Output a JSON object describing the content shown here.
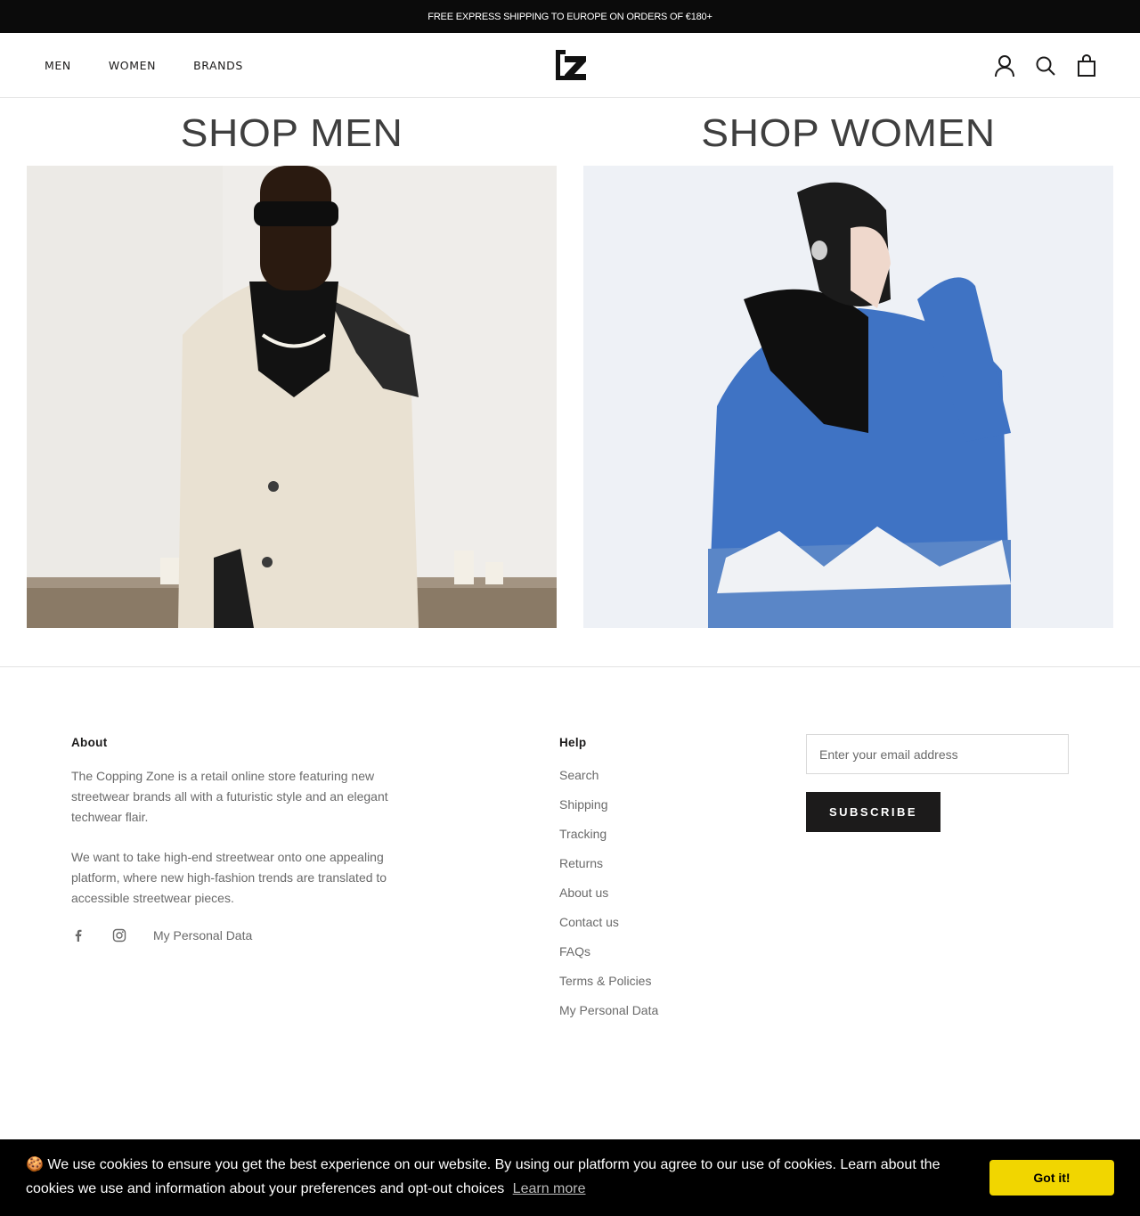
{
  "announcement": "FREE EXPRESS SHIPPING TO EUROPE ON ORDERS OF €180+",
  "header": {
    "nav": [
      "MEN",
      "WOMEN",
      "BRANDS"
    ],
    "logo_text": "CZ",
    "icons": [
      "account-icon",
      "search-icon",
      "cart-icon"
    ]
  },
  "shop": {
    "men_title": "SHOP MEN",
    "women_title": "SHOP WOMEN"
  },
  "footer": {
    "about": {
      "title": "About",
      "p1": "The Copping Zone is a retail online store featuring new streetwear brands all with a futuristic style and an elegant techwear flair.",
      "p2": "We want to take high-end streetwear onto one appealing platform, where new high-fashion trends are translated to accessible streetwear pieces.",
      "social_icons": [
        "facebook-icon",
        "instagram-icon"
      ],
      "personal_data": "My Personal Data"
    },
    "help": {
      "title": "Help",
      "links": [
        "Search",
        "Shipping",
        "Tracking",
        "Returns",
        "About us",
        "Contact us",
        "FAQs",
        "Terms & Policies",
        "My Personal Data"
      ]
    },
    "newsletter": {
      "placeholder": "Enter your email address",
      "button": "SUBSCRIBE"
    }
  },
  "cookie": {
    "icon": "🍪",
    "message": "We use cookies to ensure you get the best experience on our website. By using our platform you agree to our use of cookies. Learn about the cookies we use and information about your preferences and opt-out choices",
    "learn_more": "Learn more",
    "button": "Got it!",
    "button_color": "#f1d600"
  },
  "colors": {
    "announcement_bg": "#0b0b0b",
    "text": "#1c1b1b",
    "muted": "#6a6a6a",
    "cookie_bg": "#000000"
  }
}
